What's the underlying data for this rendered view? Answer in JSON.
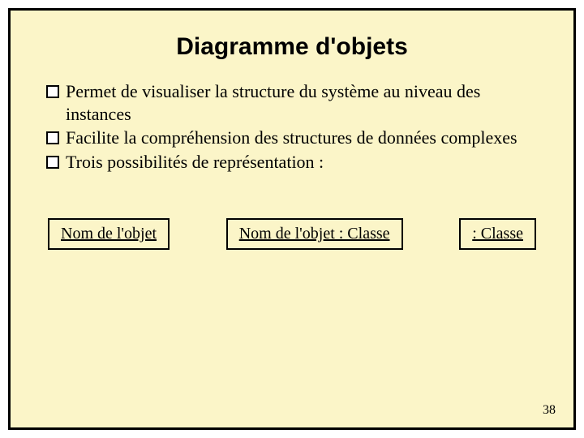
{
  "title": "Diagramme d'objets",
  "bullets": [
    "Permet de visualiser la structure du système au niveau des instances",
    "Facilite la compréhension des structures de données complexes",
    "Trois possibilités de représentation :"
  ],
  "boxes": [
    "Nom de l'objet",
    "Nom de l'objet : Classe",
    ": Classe"
  ],
  "page_number": "38"
}
